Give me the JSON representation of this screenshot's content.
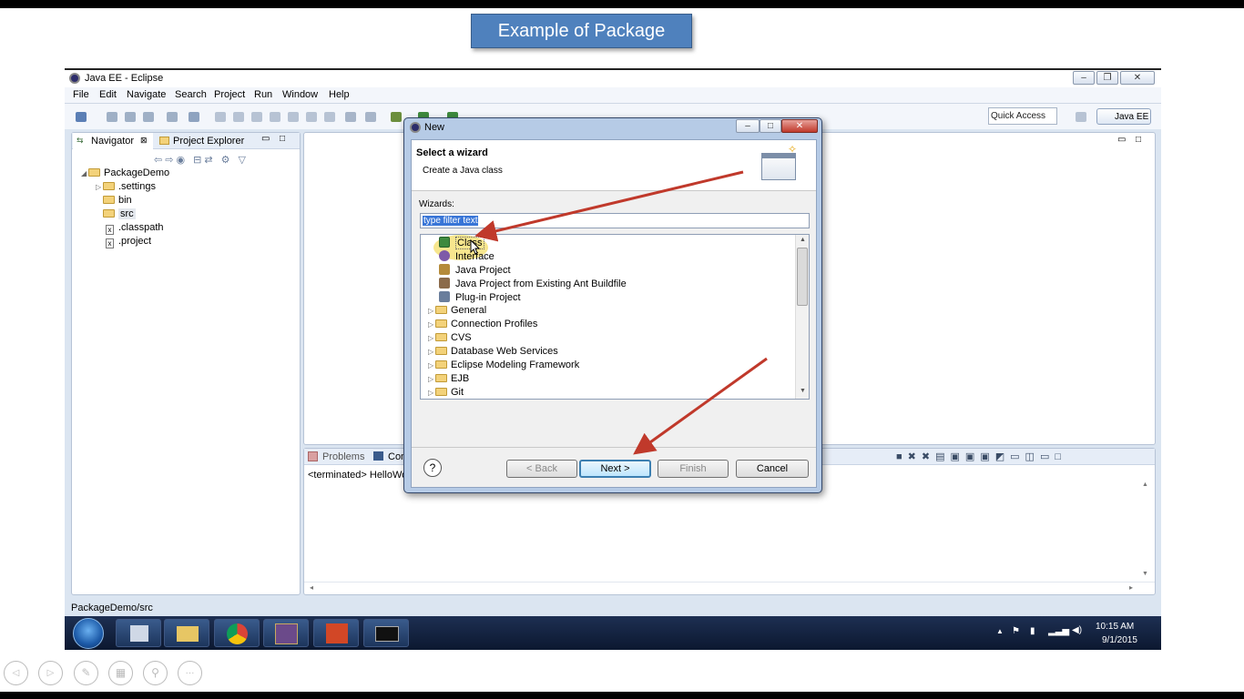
{
  "slide": {
    "title": "Example of Package"
  },
  "window": {
    "title": "Java EE - Eclipse"
  },
  "menu": [
    "File",
    "Edit",
    "Navigate",
    "Search",
    "Project",
    "Run",
    "Window",
    "Help"
  ],
  "toolbar": {
    "quick_access": "Quick Access",
    "perspective": "Java EE"
  },
  "left_panel": {
    "tabs": [
      "Navigator",
      "Project Explorer"
    ],
    "tree": [
      ".settings",
      "bin",
      "src",
      ".classpath",
      ".project"
    ],
    "project": "PackageDemo"
  },
  "bottom_panel": {
    "tabs": [
      "Problems",
      "Con"
    ],
    "console_text": "<terminated> HelloWo"
  },
  "status": {
    "path": "PackageDemo/src"
  },
  "taskbar": {
    "time": "10:15 AM",
    "date": "9/1/2015"
  },
  "dialog": {
    "title": "New",
    "heading": "Select a wizard",
    "subheading": "Create a Java class",
    "wizards_label": "Wizards:",
    "filter_text": "type filter text",
    "items": [
      "Class",
      "Interface",
      "Java Project",
      "Java Project from Existing Ant Buildfile",
      "Plug-in Project"
    ],
    "folders": [
      "General",
      "Connection Profiles",
      "CVS",
      "Database Web Services",
      "Eclipse Modeling Framework",
      "EJB",
      "Git"
    ],
    "buttons": {
      "help": "?",
      "back": "< Back",
      "next": "Next >",
      "finish": "Finish",
      "cancel": "Cancel"
    }
  },
  "colors": {
    "slide_title": "#4f81bd",
    "arrow": "#c0392b",
    "highlight": "#f6e27a"
  }
}
